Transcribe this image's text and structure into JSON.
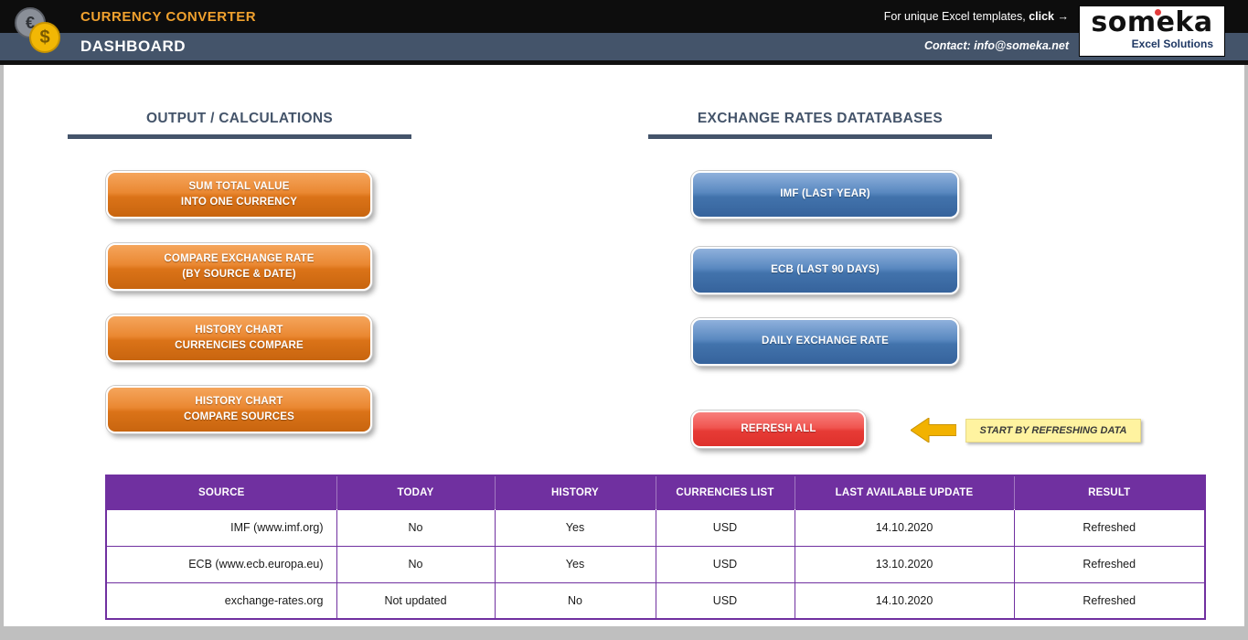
{
  "header": {
    "app_title": "CURRENCY CONVERTER",
    "dashboard_title": "DASHBOARD",
    "promo_prefix": "For unique Excel templates, ",
    "promo_click": "click",
    "promo_arrow": "→",
    "contact": "Contact: info@someka.net",
    "logo_word": "someka",
    "logo_sub": "Excel Solutions",
    "coin_euro": "€",
    "coin_dollar": "$"
  },
  "sections": {
    "left": {
      "title": "OUTPUT / CALCULATIONS",
      "buttons": [
        "SUM TOTAL VALUE\nINTO ONE CURRENCY",
        "COMPARE EXCHANGE RATE\n(BY SOURCE & DATE)",
        "HISTORY CHART\nCURRENCIES COMPARE",
        "HISTORY CHART\nCOMPARE SOURCES"
      ]
    },
    "right": {
      "title": "EXCHANGE RATES DATATABASES",
      "buttons": [
        "IMF (LAST YEAR)",
        "ECB (LAST 90 DAYS)",
        "DAILY EXCHANGE RATE"
      ],
      "refresh_label": "REFRESH ALL",
      "note": "START BY REFRESHING DATA"
    }
  },
  "table": {
    "headers": [
      "SOURCE",
      "TODAY",
      "HISTORY",
      "CURRENCIES LIST",
      "LAST AVAILABLE UPDATE",
      "RESULT"
    ],
    "rows": [
      [
        "IMF (www.imf.org)",
        "No",
        "Yes",
        "USD",
        "14.10.2020",
        "Refreshed"
      ],
      [
        "ECB (www.ecb.europa.eu)",
        "No",
        "Yes",
        "USD",
        "13.10.2020",
        "Refreshed"
      ],
      [
        "exchange-rates.org",
        "Not updated",
        "No",
        "USD",
        "14.10.2020",
        "Refreshed"
      ]
    ]
  },
  "colors": {
    "accent_orange": "#E8832C",
    "accent_blue": "#4273AC",
    "accent_red": "#E73B36",
    "header_slate": "#44546A",
    "table_purple": "#7030A0",
    "note_yellow": "#FFF3A0",
    "title_orange": "#F0A12E"
  }
}
